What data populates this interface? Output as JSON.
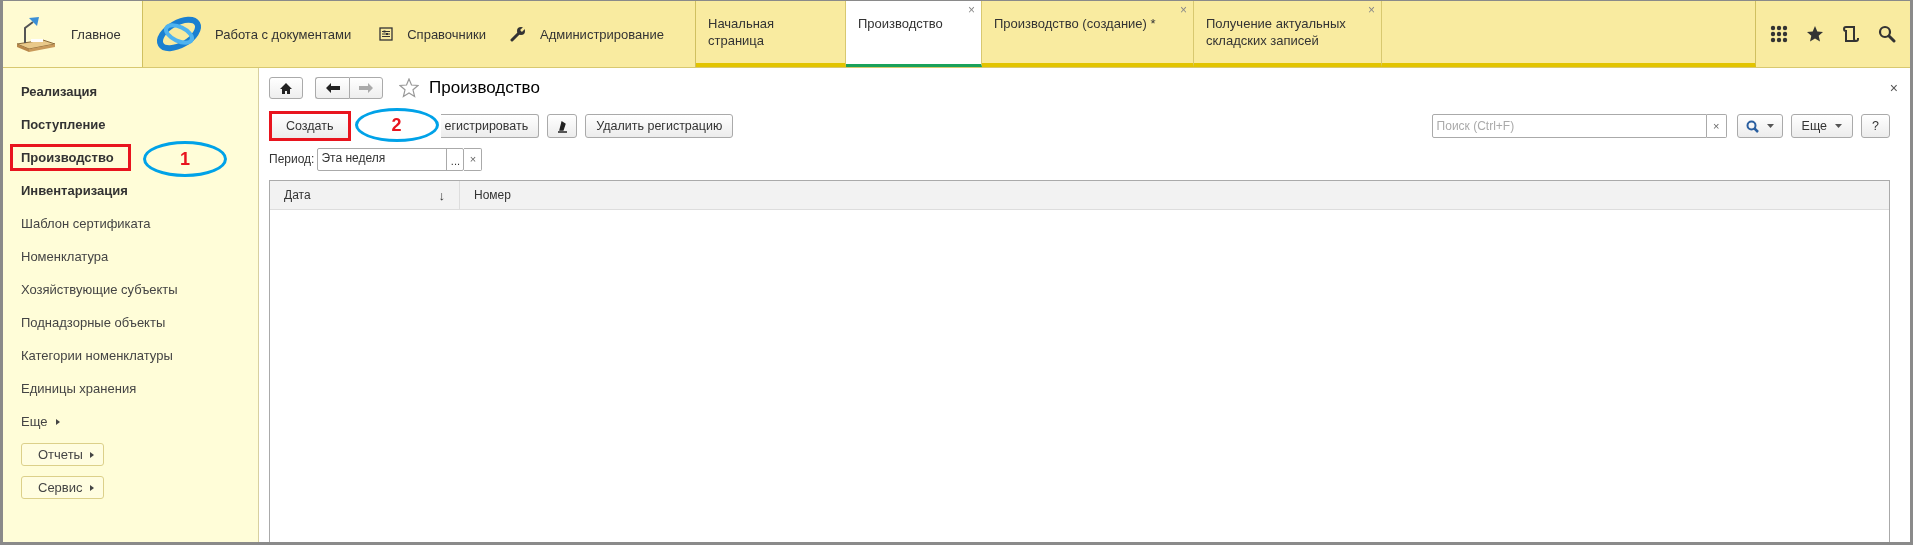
{
  "home": {
    "label": "Главное"
  },
  "sections": [
    {
      "kind": "logo",
      "label": "Работа с документами"
    },
    {
      "kind": "list",
      "label": "Справочники"
    },
    {
      "kind": "wrench",
      "label": "Администрирование"
    }
  ],
  "tabs": [
    {
      "label": "Начальная страница",
      "selected": false
    },
    {
      "label": "Производство",
      "selected": true,
      "close": "×"
    },
    {
      "label": "Производство (создание) *",
      "selected": false,
      "close": "×"
    },
    {
      "label": "Получение актуальных складских записей",
      "selected": false,
      "close": "×"
    }
  ],
  "sidebar": {
    "items": [
      {
        "label": "Реализация",
        "bold": true,
        "highlighted": false
      },
      {
        "label": "Поступление",
        "bold": true,
        "highlighted": false
      },
      {
        "label": "Производство",
        "bold": true,
        "highlighted": true,
        "callout": "1"
      },
      {
        "label": "Инвентаризация",
        "bold": true,
        "highlighted": false
      },
      {
        "label": "Шаблон сертификата",
        "bold": false,
        "highlighted": false
      },
      {
        "label": "Номенклатура",
        "bold": false,
        "highlighted": false
      },
      {
        "label": "Хозяйствующие субъекты",
        "bold": false,
        "highlighted": false
      },
      {
        "label": "Поднадзорные объекты",
        "bold": false,
        "highlighted": false
      },
      {
        "label": "Категории номенклатуры",
        "bold": false,
        "highlighted": false
      },
      {
        "label": "Единицы хранения",
        "bold": false,
        "highlighted": false
      }
    ],
    "more": "Еще",
    "buttons": [
      "Отчеты",
      "Сервис"
    ]
  },
  "form": {
    "title": "Производство",
    "close": "×",
    "buttons": [
      {
        "kind": "text",
        "label": "Создать",
        "highlighted": true,
        "callout": "2"
      },
      {
        "kind": "text",
        "label": "егистрировать",
        "highlighted": false
      },
      {
        "kind": "icon",
        "highlighted": false
      },
      {
        "kind": "text",
        "label": "Удалить регистрацию",
        "highlighted": false
      }
    ],
    "search": {
      "placeholder": "Поиск (Ctrl+F)",
      "clear": "×"
    },
    "more": "Еще",
    "help": "?",
    "period": {
      "label": "Период:",
      "value": "Эта неделя",
      "choose": "...",
      "clear": "×"
    },
    "table": {
      "columns": [
        {
          "label": "Дата",
          "sort": "↓"
        },
        {
          "label": "Номер"
        }
      ]
    }
  }
}
